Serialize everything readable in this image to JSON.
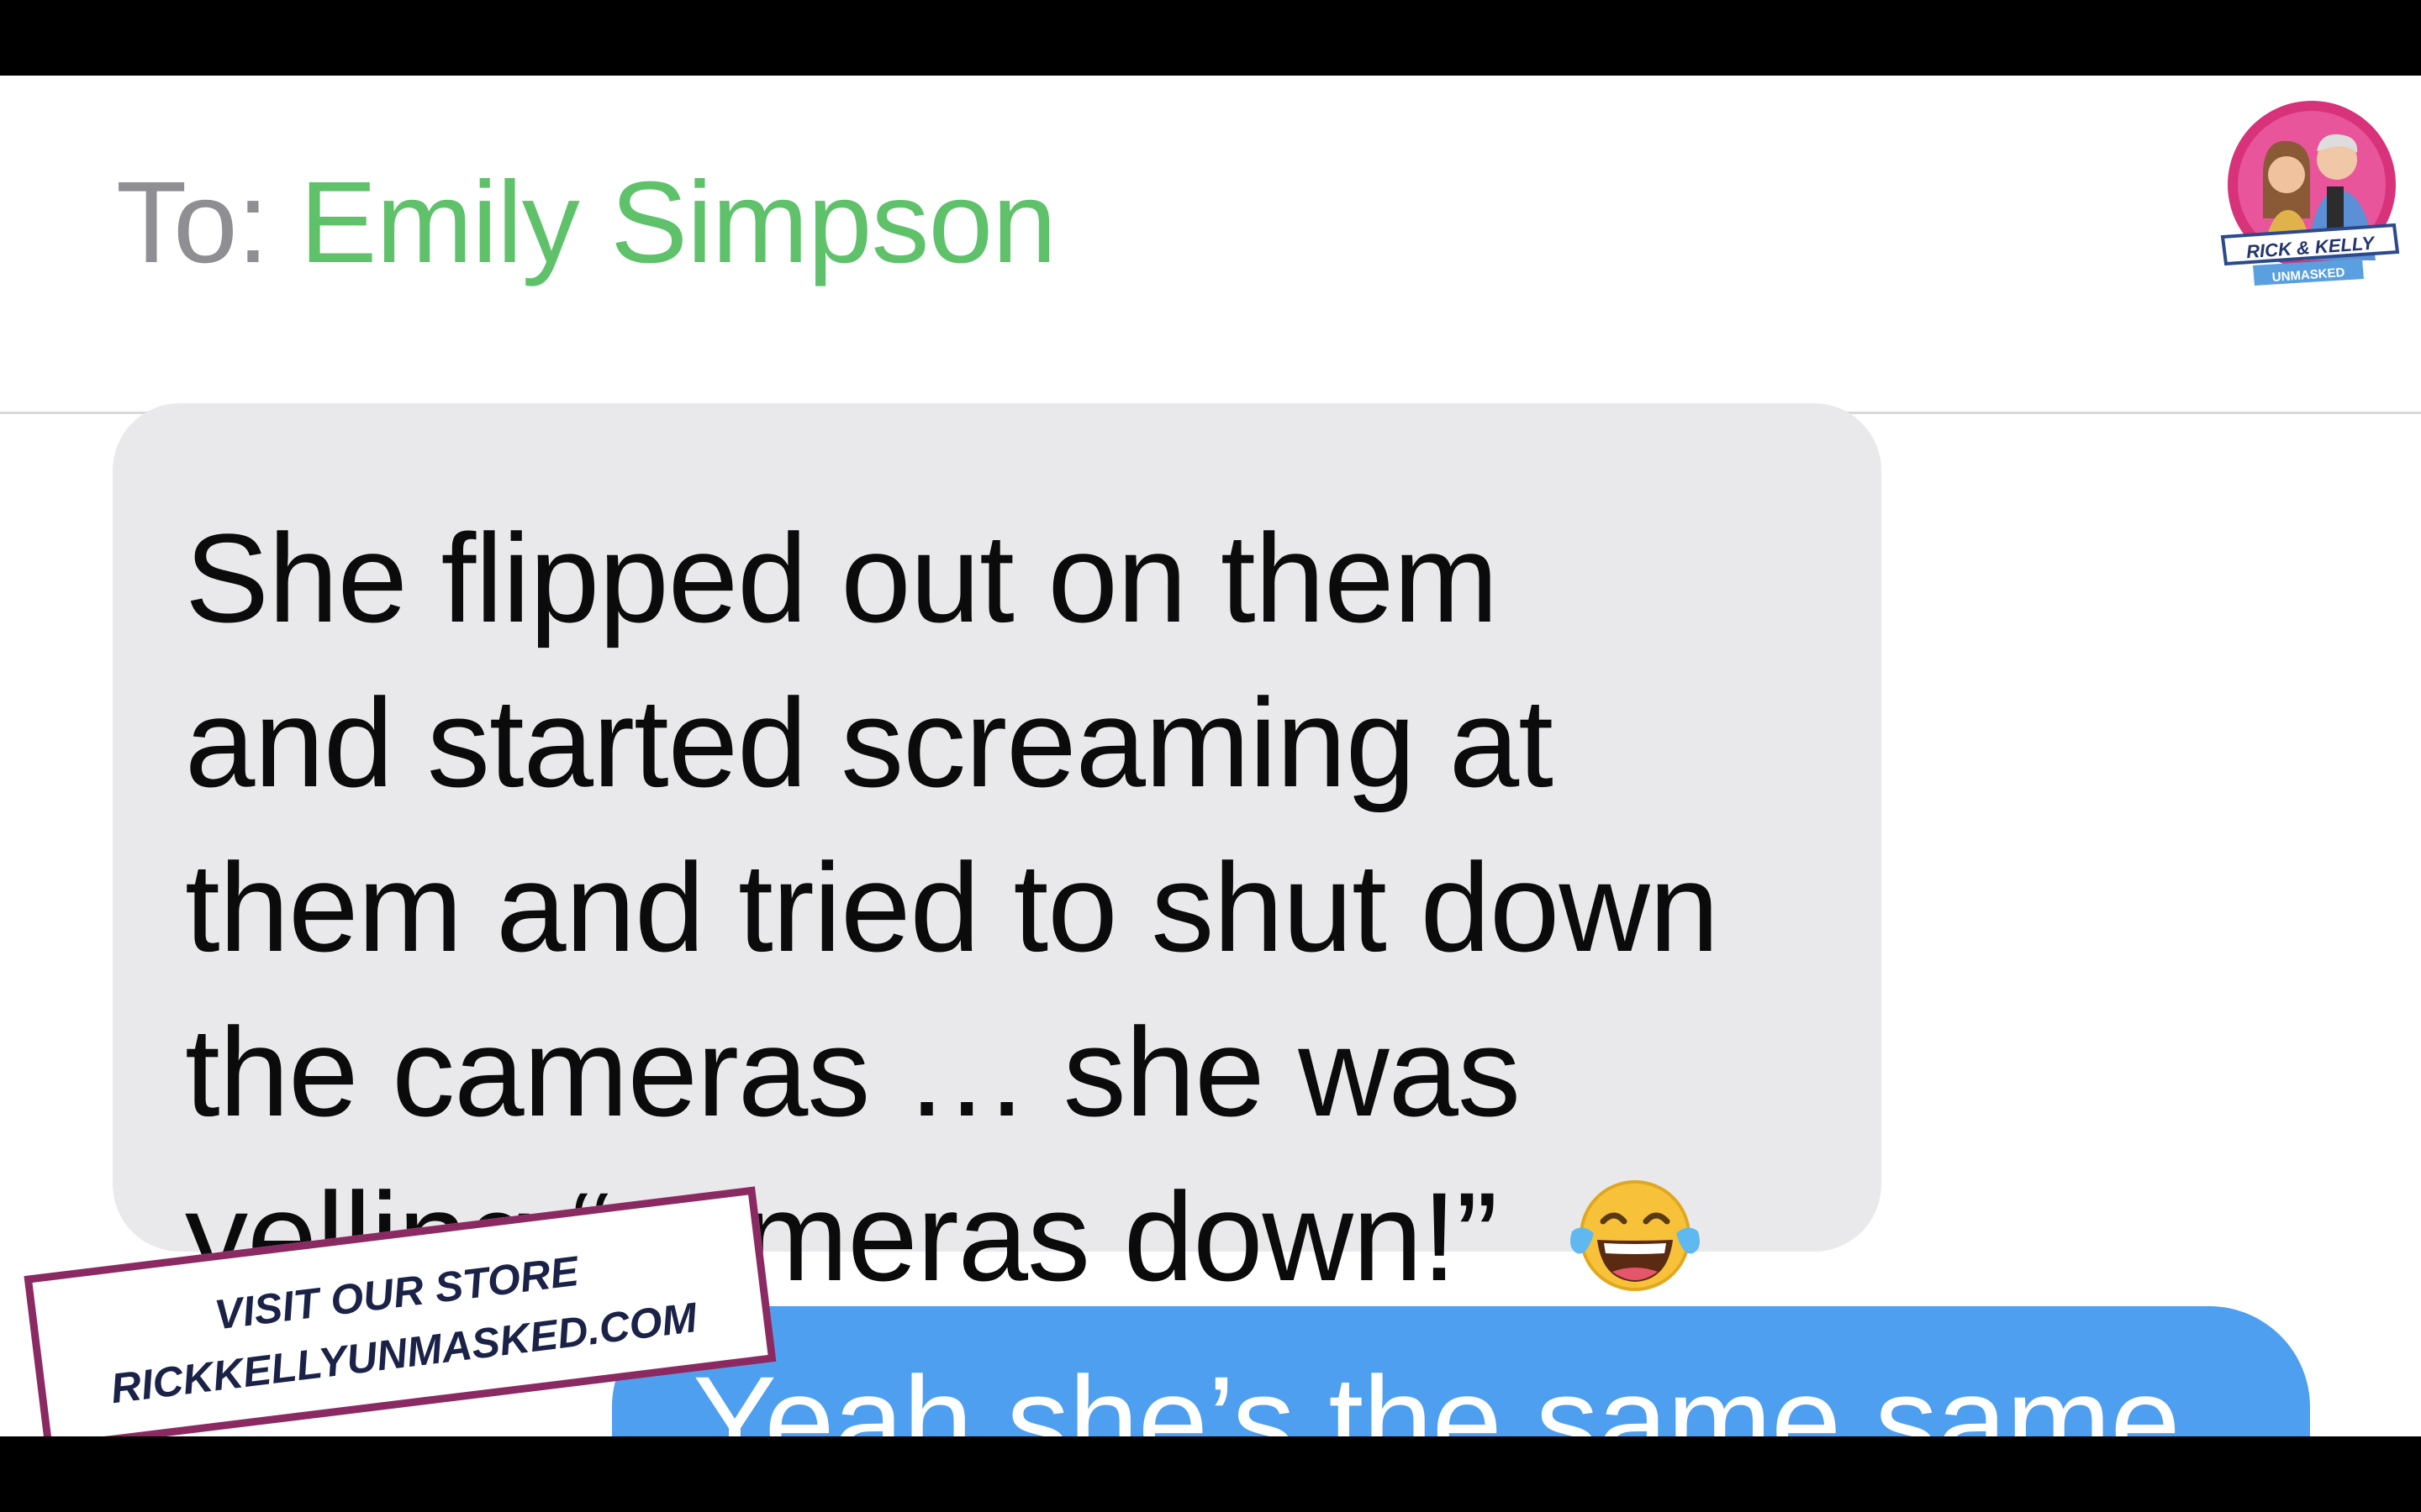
{
  "header": {
    "to_label": "To:",
    "recipient": "Emily Simpson"
  },
  "logo": {
    "line1": "RICK & KELLY",
    "line2": "UNMASKED"
  },
  "messages": {
    "incoming": {
      "lines": [
        "She flipped out on them",
        "and started screaming at",
        "them and tried to shut down",
        "the cameras … she was",
        "yelling “cameras down!”"
      ],
      "emoji": "face-with-tears-of-joy-icon"
    },
    "outgoing": {
      "text": "Yeah she’s the same same"
    }
  },
  "store_banner": {
    "line1": "VISIT OUR STORE",
    "line2": "RICKKELLYUNMASKED.COM"
  },
  "colors": {
    "recipient": "#5fc26b",
    "incoming_bubble": "#e9e9eb",
    "outgoing_bubble": "#4e9ff0",
    "banner_border": "#8b2a62"
  }
}
